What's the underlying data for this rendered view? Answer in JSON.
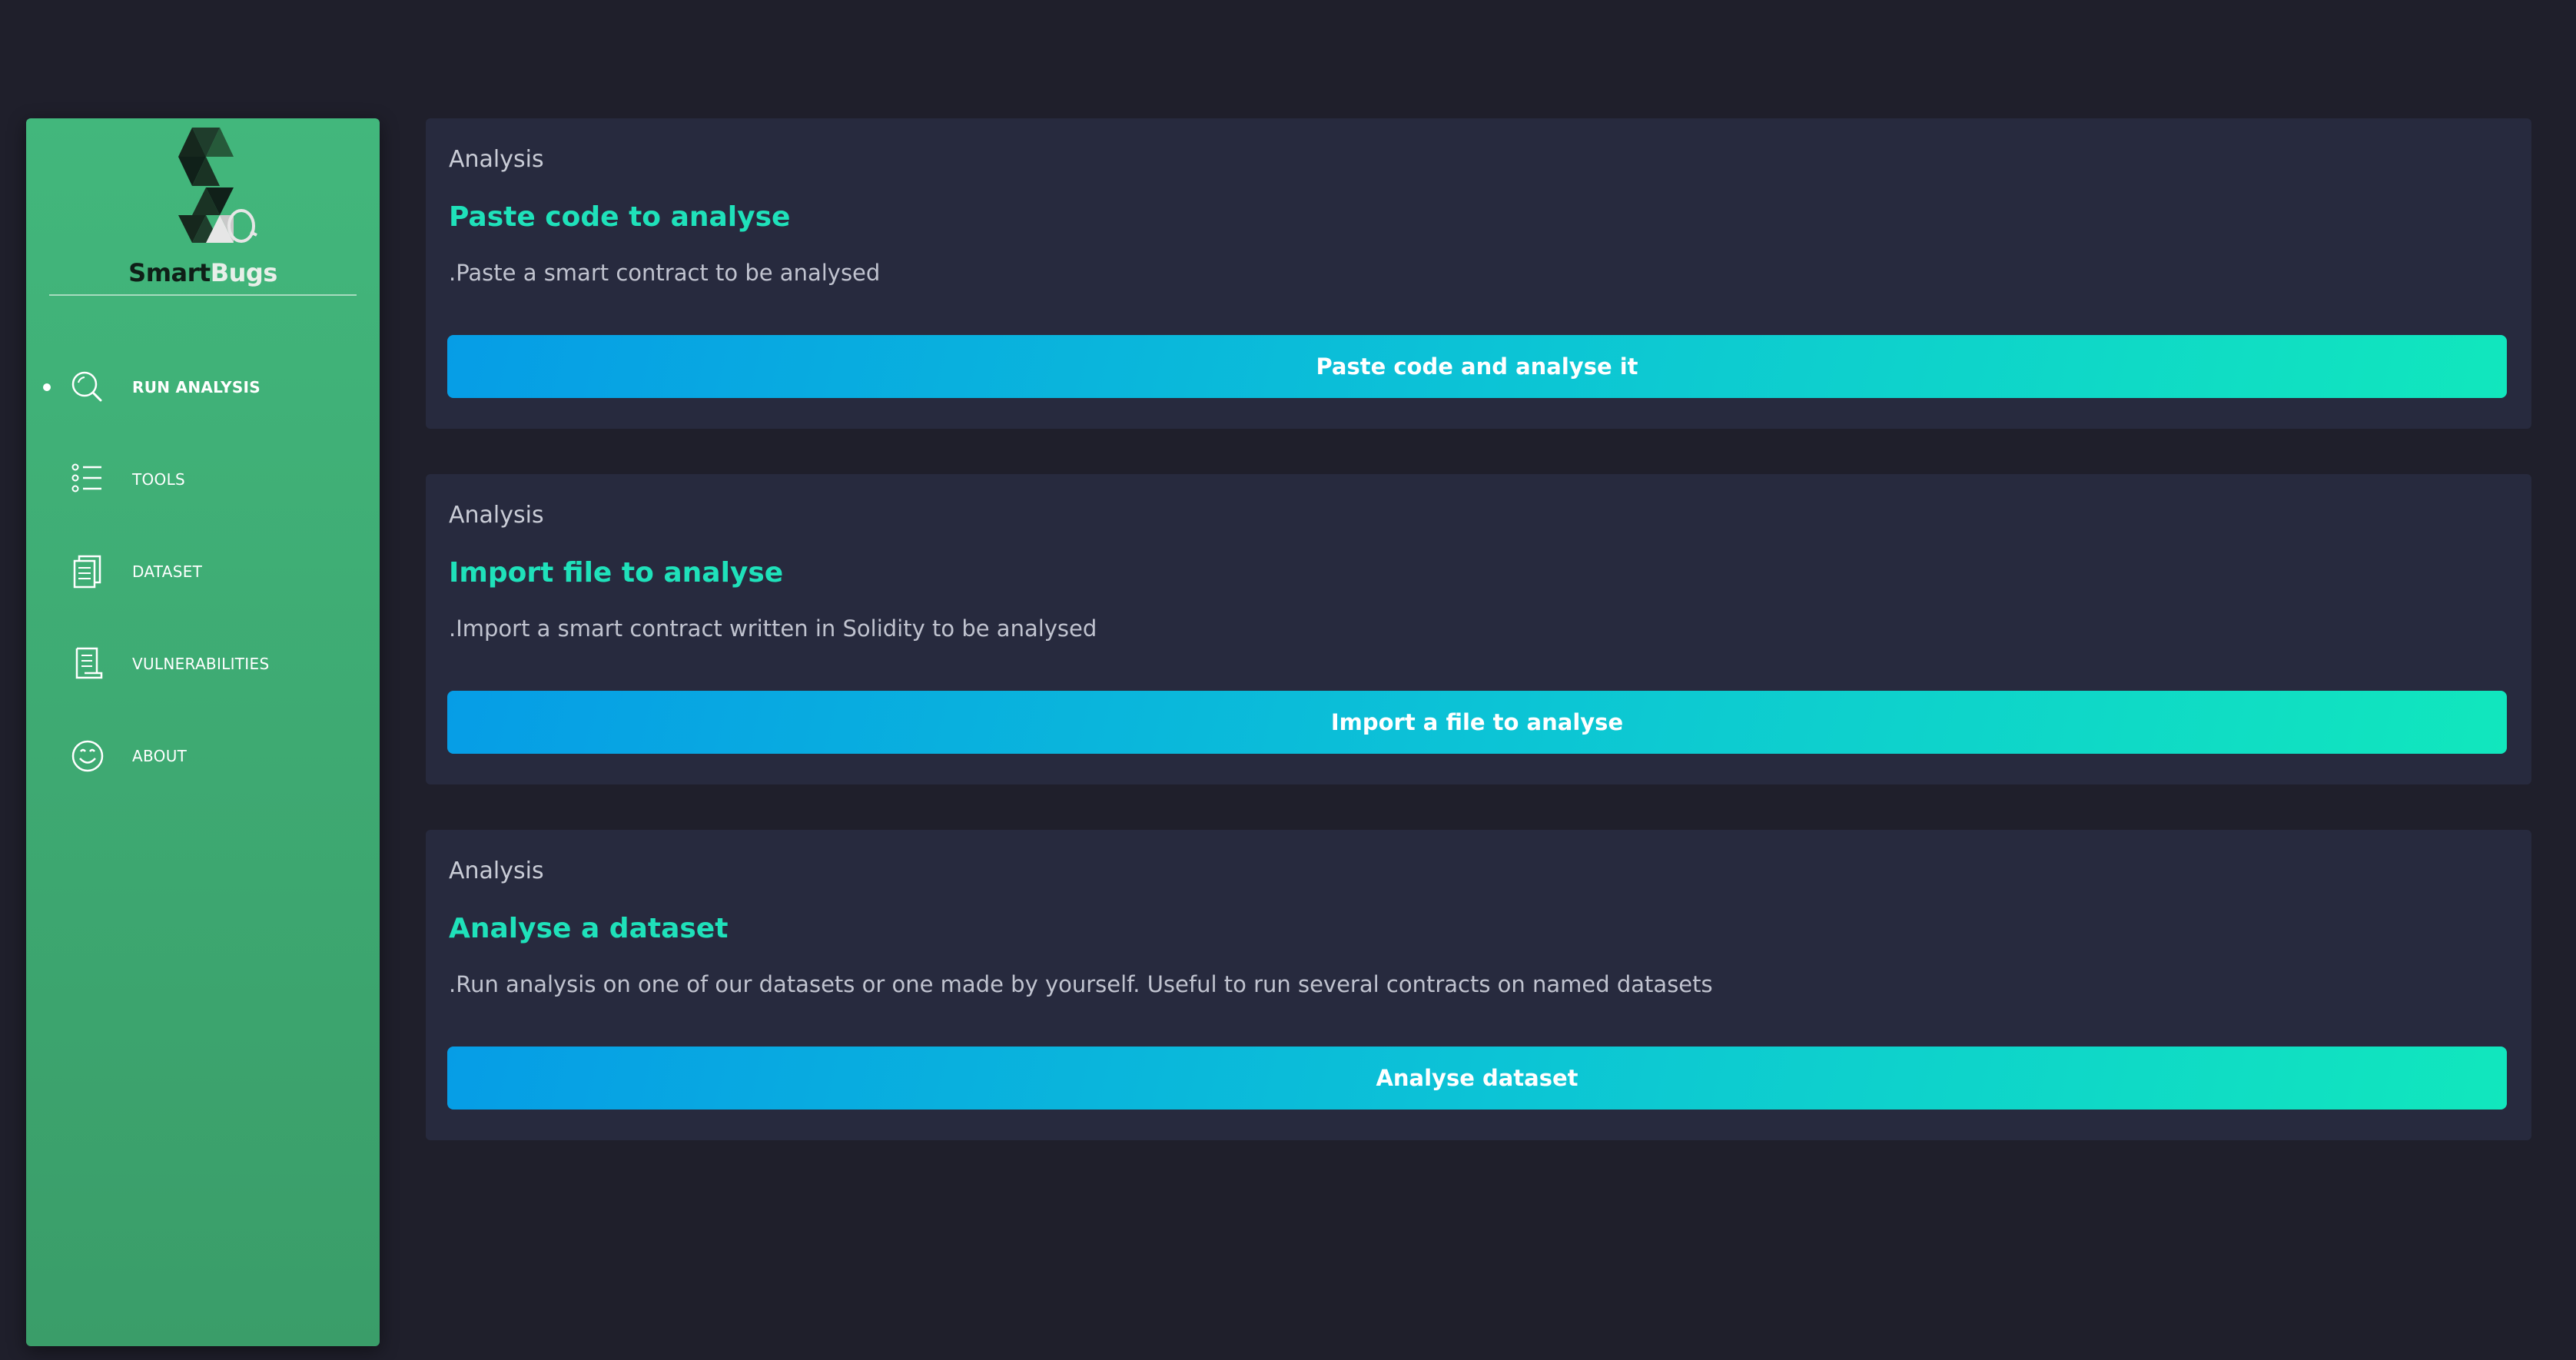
{
  "brand": {
    "name_part1": "Smart",
    "name_part2": "Bugs",
    "color_primary": "#42b77c",
    "color_accent": "#1fe1ba"
  },
  "sidebar": {
    "items": [
      {
        "label": "RUN ANALYSIS",
        "icon": "search-icon",
        "active": true
      },
      {
        "label": "TOOLS",
        "icon": "list-icon",
        "active": false
      },
      {
        "label": "DATASET",
        "icon": "document-icon",
        "active": false
      },
      {
        "label": "VULNERABILITIES",
        "icon": "scroll-icon",
        "active": false
      },
      {
        "label": "ABOUT",
        "icon": "smiley-icon",
        "active": false
      }
    ]
  },
  "cards": [
    {
      "eyebrow": "Analysis",
      "title": "Paste code to analyse",
      "description": ".Paste a smart contract to be analysed",
      "button": "Paste code and analyse it"
    },
    {
      "eyebrow": "Analysis",
      "title": "Import file to analyse",
      "description": ".Import a smart contract written in Solidity to be analysed",
      "button": "Import a file to analyse"
    },
    {
      "eyebrow": "Analysis",
      "title": "Analyse a dataset",
      "description": ".Run analysis on one of our datasets or one made by yourself. Useful to run several contracts on named datasets",
      "button": "Analyse dataset"
    }
  ],
  "colors": {
    "background": "#1f1f2b",
    "card": "#272a3e",
    "button_gradient_start": "#069de6",
    "button_gradient_end": "#11e7bd"
  }
}
